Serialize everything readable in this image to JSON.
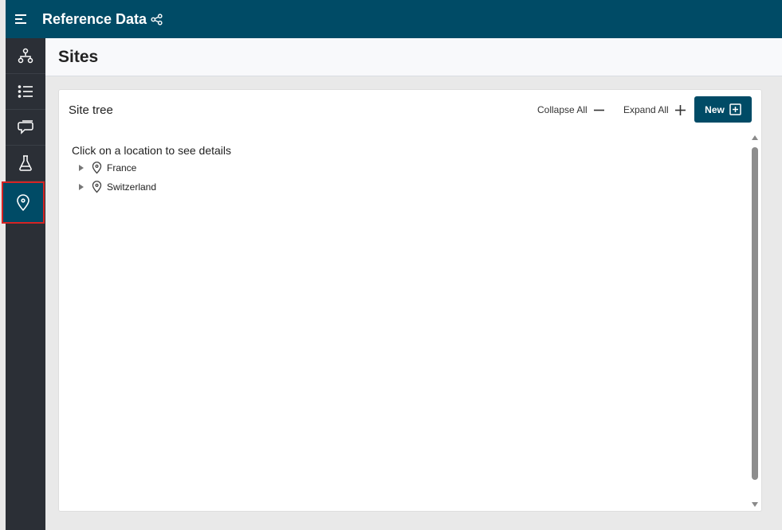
{
  "app": {
    "title": "Reference Data"
  },
  "sidebar": {
    "items": [
      {
        "icon": "hierarchy-icon"
      },
      {
        "icon": "list-icon"
      },
      {
        "icon": "chat-icon"
      },
      {
        "icon": "flask-icon"
      },
      {
        "icon": "location-pin-icon",
        "active": true
      }
    ]
  },
  "page": {
    "title": "Sites"
  },
  "card": {
    "title": "Site tree",
    "collapse_label": "Collapse All",
    "expand_label": "Expand All",
    "new_label": "New",
    "hint": "Click on a location to see details",
    "nodes": [
      "France",
      "Switzerland"
    ]
  },
  "colors": {
    "primary": "#004b66",
    "sidebar": "#2b2f36",
    "highlight": "#d62424"
  }
}
